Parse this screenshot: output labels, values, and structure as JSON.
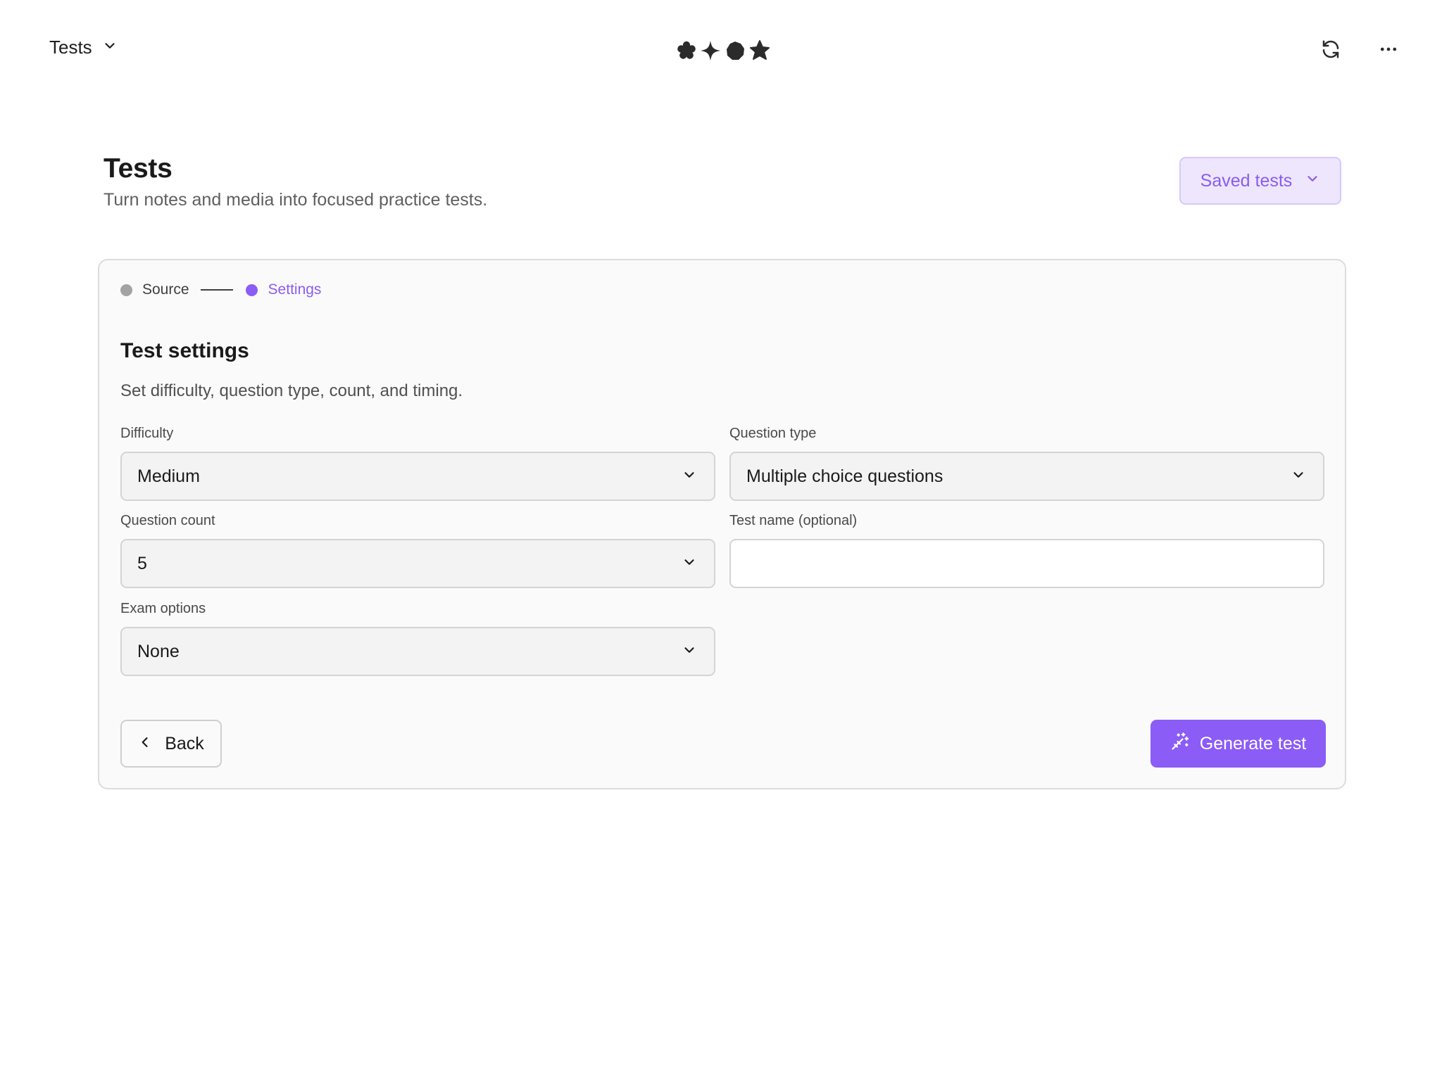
{
  "topbar": {
    "app_menu_label": "Tests",
    "icons": [
      "chevron-down-icon",
      "logo-shapes",
      "refresh-icon",
      "more-horizontal-icon"
    ]
  },
  "header": {
    "title": "Tests",
    "subtitle": "Turn notes and media into focused practice tests.",
    "saved_tests_label": "Saved tests"
  },
  "stepper": {
    "steps": [
      {
        "label": "Source",
        "state": "done"
      },
      {
        "label": "Settings",
        "state": "active"
      }
    ]
  },
  "settings": {
    "title": "Test settings",
    "description": "Set difficulty, question type, count, and timing.",
    "difficulty": {
      "label": "Difficulty",
      "value": "Medium"
    },
    "question_type": {
      "label": "Question type",
      "value": "Multiple choice questions"
    },
    "question_count": {
      "label": "Question count",
      "value": "5"
    },
    "test_name": {
      "label": "Test name (optional)",
      "value": ""
    },
    "exam_options": {
      "label": "Exam options",
      "value": "None"
    }
  },
  "actions": {
    "back_label": "Back",
    "generate_label": "Generate test"
  },
  "colors": {
    "accent": "#8b5cf6",
    "accent_soft_bg": "#ede6fd",
    "text": "#1a1a1a",
    "muted_text": "#5f5f5f"
  }
}
